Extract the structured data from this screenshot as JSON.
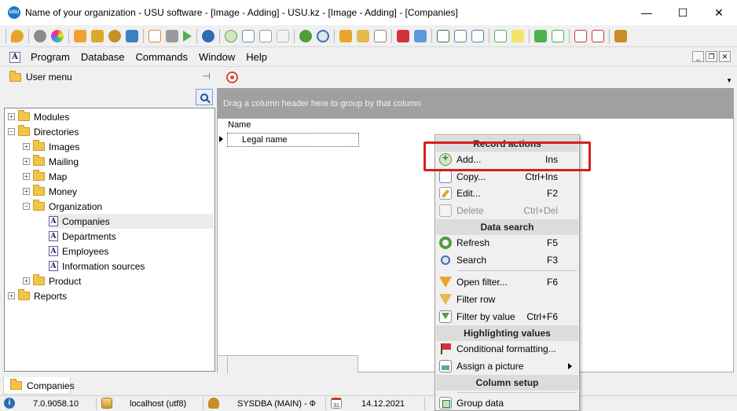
{
  "window": {
    "title": "Name of your organization - USU software - [Image - Adding] - USU.kz - [Image - Adding] - [Companies]",
    "logo_text": "USU",
    "minimize": "—",
    "maximize": "☐",
    "close": "✕"
  },
  "menubar": {
    "items": [
      "Program",
      "Database",
      "Commands",
      "Window",
      "Help"
    ],
    "mdi_minimize": "_",
    "mdi_restore": "❐",
    "mdi_close": "✕"
  },
  "left_panel": {
    "title": "User menu",
    "pin": "⊣"
  },
  "tree": [
    {
      "label": "Modules",
      "expander": "+"
    },
    {
      "label": "Directories",
      "expander": "−"
    },
    {
      "label": "Images",
      "expander": "+"
    },
    {
      "label": "Mailing",
      "expander": "+"
    },
    {
      "label": "Map",
      "expander": "+"
    },
    {
      "label": "Money",
      "expander": "+"
    },
    {
      "label": "Organization",
      "expander": "−"
    },
    {
      "label": "Companies",
      "selected": true
    },
    {
      "label": "Departments"
    },
    {
      "label": "Employees"
    },
    {
      "label": "Information sources"
    },
    {
      "label": "Product",
      "expander": "+"
    },
    {
      "label": "Reports",
      "expander": "+"
    }
  ],
  "grid": {
    "group_panel_text": "Drag a column header here to group by that column",
    "column_header": "Name",
    "cell_value": "Legal name"
  },
  "bottom_tab": {
    "label": "Companies"
  },
  "status": {
    "version": "7.0.9058.10",
    "server": "localhost (utf8)",
    "user": "SYSDBA (MAIN) - Ф",
    "calendar_day": "31",
    "date": "14.12.2021",
    "info_glyph": "i"
  },
  "context_menu": {
    "record_actions_header": "Record actions",
    "add_label": "Add...",
    "add_shortcut": "Ins",
    "copy_label": "Copy...",
    "copy_shortcut": "Ctrl+Ins",
    "edit_label": "Edit...",
    "edit_shortcut": "F2",
    "delete_label": "Delete",
    "delete_shortcut": "Ctrl+Del",
    "data_search_header": "Data search",
    "refresh_label": "Refresh",
    "refresh_shortcut": "F5",
    "search_label": "Search",
    "search_shortcut": "F3",
    "open_filter_label": "Open filter...",
    "open_filter_shortcut": "F6",
    "filter_row_label": "Filter row",
    "filter_by_value_label": "Filter by value",
    "filter_by_value_shortcut": "Ctrl+F6",
    "highlighting_header": "Highlighting values",
    "conditional_formatting_label": "Conditional formatting...",
    "assign_picture_label": "Assign a picture",
    "column_setup_header": "Column setup",
    "group_data_label": "Group data"
  },
  "colors": {
    "highlight": "#d3201f",
    "group_panel": "#a0a0a0",
    "menu_header": "#dcdcdc"
  }
}
